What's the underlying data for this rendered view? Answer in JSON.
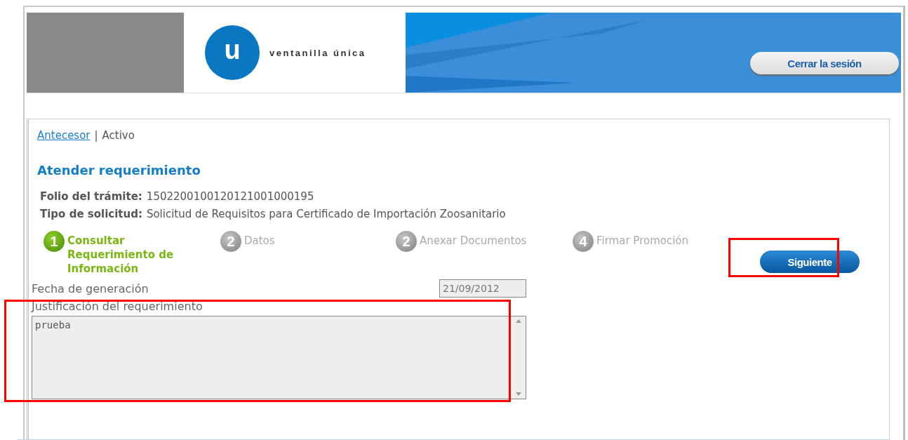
{
  "header": {
    "logo_letter": "u",
    "logo_text": "ventanilla única",
    "logout_button": "Cerrar la sesión"
  },
  "breadcrumb_separator": "|",
  "breadcrumb": [
    {
      "label": "Antecesor",
      "link": true
    },
    {
      "label": "Activo",
      "link": false
    }
  ],
  "title": "Atender requerimiento",
  "details": [
    {
      "label": "Folio del trámite:",
      "value": "1502200100120121001000195"
    },
    {
      "label": "Tipo de solicitud:",
      "value": "Solicitud de Requisitos para Certificado de Importación Zoosanitario"
    }
  ],
  "steps": [
    {
      "number": "1",
      "label": "Consultar Requerimiento de Información",
      "active": true
    },
    {
      "number": "2",
      "label": "Datos",
      "active": false
    },
    {
      "number": "2",
      "label": "Anexar Documentos",
      "active": false
    },
    {
      "number": "4",
      "label": "Firmar Promoción",
      "active": false
    }
  ],
  "next_button": {
    "label": "Siguiente",
    "highlighted": true
  },
  "fields": [
    {
      "kind": "text",
      "label": "Fecha de generación",
      "value": "21/09/2012",
      "highlighted": false
    },
    {
      "kind": "textarea",
      "label": "Justificación del requerimiento",
      "value": "prueba",
      "highlighted": true
    }
  ]
}
